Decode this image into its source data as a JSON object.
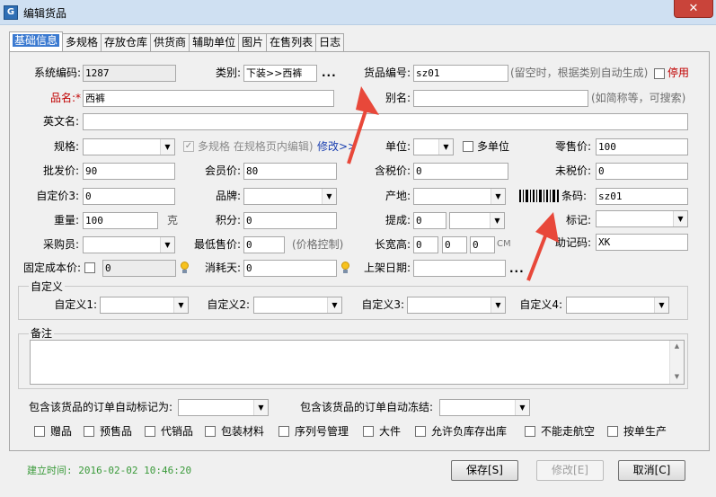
{
  "window": {
    "title": "编辑货品",
    "app_icon": "app-icon",
    "close": "✕"
  },
  "tabs": [
    "基础信息",
    "多规格",
    "存放仓库",
    "供货商",
    "辅助单位",
    "图片",
    "在售列表",
    "日志"
  ],
  "form": {
    "system_code": {
      "label": "系统编码:",
      "value": "1287"
    },
    "category": {
      "label": "类别:",
      "value": "下装>>西裤",
      "more": "..."
    },
    "goods_code": {
      "label": "货品编号:",
      "value": "sz01",
      "hint": "(留空时，根据类别自动生成)"
    },
    "disabled_flag": {
      "label": "停用"
    },
    "name": {
      "label": "品名:",
      "required_mark": "*",
      "value": "西裤"
    },
    "alias": {
      "label": "别名:",
      "value": "",
      "hint": "(如简称等，可搜索)"
    },
    "english_name": {
      "label": "英文名:",
      "value": ""
    },
    "spec": {
      "label": "规格:",
      "value": ""
    },
    "multi_spec": {
      "label": "多规格 在规格页内编辑)",
      "link": "修改>>"
    },
    "unit": {
      "label": "单位:",
      "value": ""
    },
    "multi_unit": {
      "label": "多单位"
    },
    "retail_price": {
      "label": "零售价:",
      "value": "100"
    },
    "wholesale_price": {
      "label": "批发价:",
      "value": "90"
    },
    "member_price": {
      "label": "会员价:",
      "value": "80"
    },
    "tax_price": {
      "label": "含税价:",
      "value": "0"
    },
    "pre_tax_price": {
      "label": "未税价:",
      "value": "0"
    },
    "custom_price3": {
      "label": "自定价3:",
      "value": "0"
    },
    "brand": {
      "label": "品牌:",
      "value": ""
    },
    "origin": {
      "label": "产地:",
      "value": ""
    },
    "barcode": {
      "label": "条码:",
      "value": "sz01",
      "icon": "barcode-icon"
    },
    "weight": {
      "label": "重量:",
      "value": "100",
      "unit": "克"
    },
    "points": {
      "label": "积分:",
      "value": "0"
    },
    "commission": {
      "label": "提成:",
      "value": "0"
    },
    "mark": {
      "label": "标记:",
      "value": ""
    },
    "buyer": {
      "label": "采购员:",
      "value": ""
    },
    "min_price": {
      "label": "最低售价:",
      "value": "0",
      "hint": "(价格控制)"
    },
    "dimensions": {
      "label": "长宽高:",
      "l": "0",
      "w": "0",
      "h": "0",
      "unit": "CM"
    },
    "mnemonic": {
      "label": "助记码:",
      "value": "XK"
    },
    "fixed_cost": {
      "label": "固定成本价:",
      "value": "0"
    },
    "consume_days": {
      "label": "消耗天:",
      "value": "0"
    },
    "listing_date": {
      "label": "上架日期:",
      "value": "",
      "more": "..."
    }
  },
  "custom": {
    "title": "自定义",
    "fields": [
      {
        "label": "自定义1:",
        "value": ""
      },
      {
        "label": "自定义2:",
        "value": ""
      },
      {
        "label": "自定义3:",
        "value": ""
      },
      {
        "label": "自定义4:",
        "value": ""
      }
    ]
  },
  "remarks": {
    "title": "备注",
    "value": ""
  },
  "auto_mark": {
    "label": "包含该货品的订单自动标记为:",
    "value": ""
  },
  "auto_freeze": {
    "label": "包含该货品的订单自动冻结:",
    "value": ""
  },
  "options": [
    "赠品",
    "预售品",
    "代销品",
    "包装材料",
    "序列号管理",
    "大件",
    "允许负库存出库",
    "不能走航空",
    "按单生产"
  ],
  "footer": {
    "created": "建立时间: 2016-02-02 10:46:20",
    "save": "保存[S]",
    "modify": "修改[E]",
    "cancel": "取消[C]"
  },
  "colors": {
    "accent": "#3a79d0",
    "required": "#c00000",
    "annotation_arrow": "#e8483a",
    "created_text": "#3a9a3a"
  }
}
